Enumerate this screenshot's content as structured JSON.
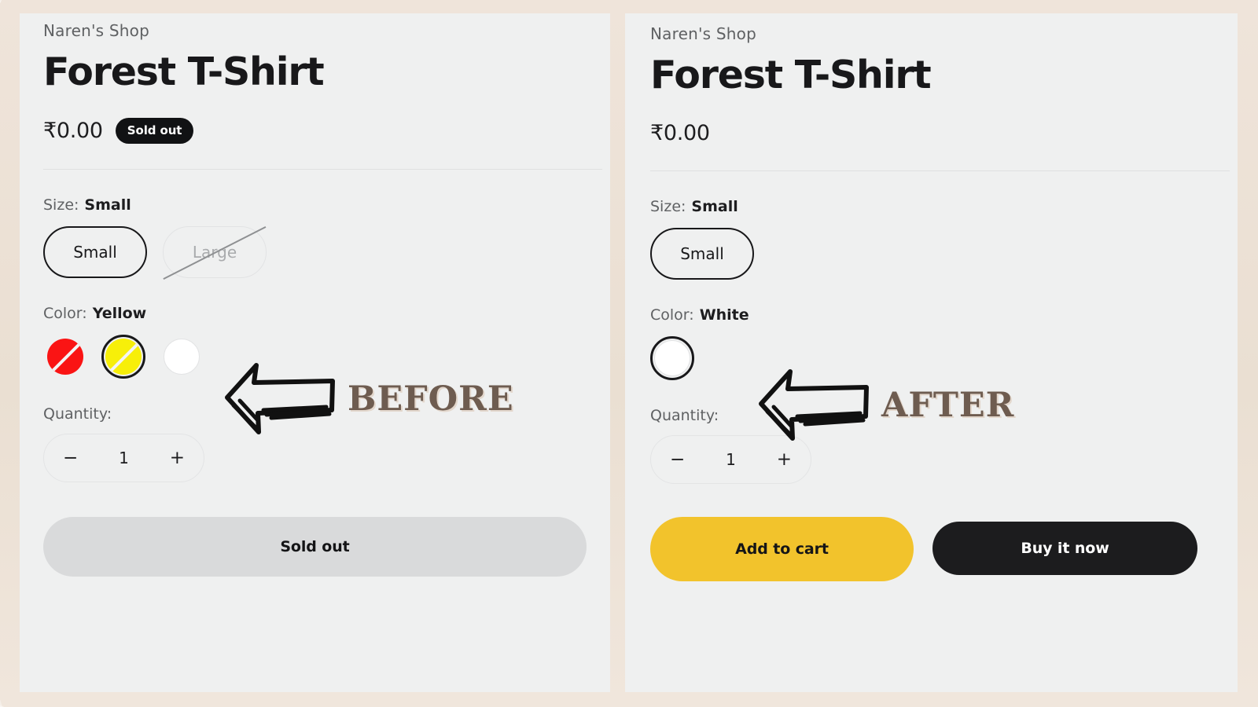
{
  "background": {
    "color": "#ece1d6",
    "texture": "marble-paper"
  },
  "panels": {
    "before": {
      "vendor": "Naren's Shop",
      "title": "Forest T-Shirt",
      "price": "₹0.00",
      "badge": "Sold out",
      "size": {
        "label": "Size:",
        "selected": "Small",
        "options": [
          {
            "label": "Small",
            "state": "selected"
          },
          {
            "label": "Large",
            "state": "unavailable"
          }
        ]
      },
      "color": {
        "label": "Color:",
        "selected": "Yellow",
        "options": [
          {
            "name": "Red",
            "hex": "#fa1414",
            "state": "unavailable"
          },
          {
            "name": "Yellow",
            "hex": "#f7ef09",
            "state": "selected-unavailable"
          },
          {
            "name": "White",
            "hex": "#ffffff",
            "state": "available"
          }
        ]
      },
      "quantity": {
        "label": "Quantity:",
        "decrement": "−",
        "value": "1",
        "increment": "+"
      },
      "actions": [
        {
          "label": "Sold out",
          "style": "disabled"
        }
      ]
    },
    "after": {
      "vendor": "Naren's Shop",
      "title": "Forest T-Shirt",
      "price": "₹0.00",
      "badge": "",
      "size": {
        "label": "Size:",
        "selected": "Small",
        "options": [
          {
            "label": "Small",
            "state": "selected"
          }
        ]
      },
      "color": {
        "label": "Color:",
        "selected": "White",
        "options": [
          {
            "name": "White",
            "hex": "#ffffff",
            "state": "selected"
          }
        ]
      },
      "quantity": {
        "label": "Quantity:",
        "decrement": "−",
        "value": "1",
        "increment": "+"
      },
      "actions": [
        {
          "label": "Add to cart",
          "style": "primary-yellow"
        },
        {
          "label": "Buy it now",
          "style": "primary-dark"
        }
      ]
    }
  },
  "annotations": {
    "before": {
      "text": "BEFORE",
      "icon": "hand-drawn-left-arrow-icon",
      "color": "#6e5c50"
    },
    "after": {
      "text": "AFTER",
      "icon": "hand-drawn-left-arrow-icon",
      "color": "#6e5c50"
    }
  }
}
